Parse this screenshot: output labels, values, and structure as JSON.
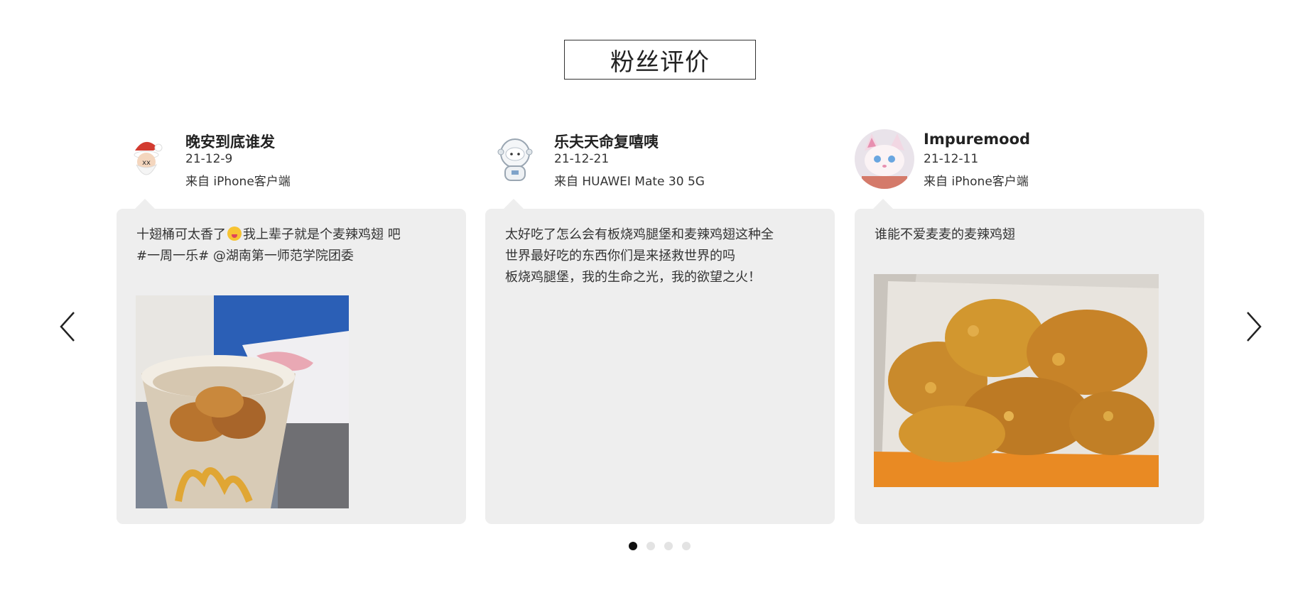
{
  "section": {
    "title": "粉丝评价"
  },
  "nav": {
    "prev_icon": "chevron-left-icon",
    "next_icon": "chevron-right-icon"
  },
  "reviews": [
    {
      "name": "晚安到底谁发",
      "date": "21-12-9",
      "source": "来自 iPhone客户端",
      "avatar_icon": "santa-avatar",
      "text_lines": [
        {
          "before": "十翅桶可太香了",
          "emoji": "laughing-emoji",
          "after": "我上辈子就是个麦辣鸡翅 吧"
        },
        {
          "before": "#一周一乐# @湖南第一师范学院团委"
        }
      ],
      "photo": "mcdonalds-chicken-bucket-photo"
    },
    {
      "name": "乐夫天命复嘻咦",
      "date": "21-12-21",
      "source": "来自 HUAWEI Mate 30 5G",
      "avatar_icon": "astronaut-avatar",
      "text_lines": [
        {
          "before": "太好吃了怎么会有板烧鸡腿堡和麦辣鸡翅这种全"
        },
        {
          "before": "世界最好吃的东西你们是来拯救世界的吗"
        },
        {
          "before": "板烧鸡腿堡，我的生命之光，我的欲望之火！"
        }
      ]
    },
    {
      "name": "Impuremood",
      "date": "21-12-11",
      "source": "来自 iPhone客户端",
      "avatar_icon": "plush-toy-avatar",
      "text_lines": [
        {
          "before": "谁能不爱麦麦的麦辣鸡翅"
        }
      ],
      "photo": "fried-chicken-wings-photo"
    }
  ],
  "pagination": {
    "count": 4,
    "active": 0
  }
}
